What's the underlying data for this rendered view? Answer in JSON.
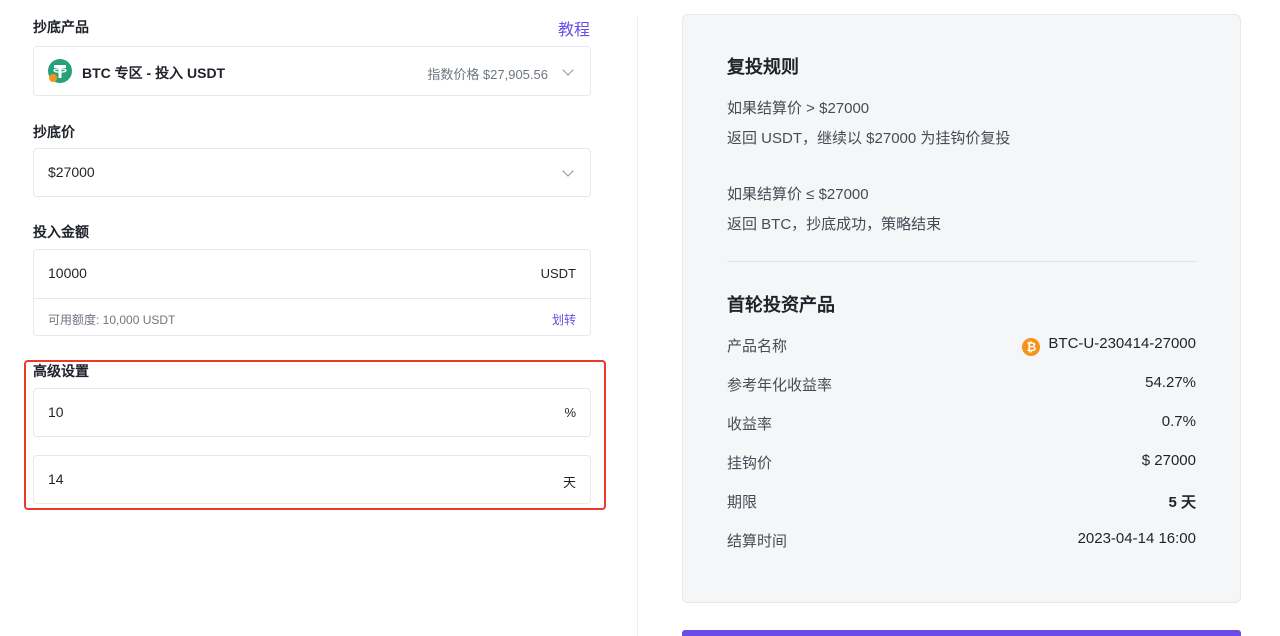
{
  "left": {
    "product": {
      "label": "抄底产品",
      "tutorial": "教程",
      "name": "BTC 专区 - 投入 USDT",
      "index_price": "指数价格 $27,905.56"
    },
    "price": {
      "label": "抄底价",
      "value": "$27000"
    },
    "amount": {
      "label": "投入金额",
      "value": "10000",
      "unit": "USDT",
      "available": "可用额度: 10,000 USDT",
      "transfer": "划转"
    },
    "advanced": {
      "label": "高级设置",
      "field1": {
        "value": "10",
        "unit": "%"
      },
      "field2": {
        "value": "14",
        "unit": "天"
      }
    }
  },
  "right": {
    "rules": {
      "title": "复投规则",
      "line1": "如果结算价 > $27000",
      "line2": "返回 USDT，继续以 $27000 为挂钩价复投",
      "line3": "如果结算价 ≤ $27000",
      "line4": "返回 BTC，抄底成功，策略结束"
    },
    "first_round": {
      "title": "首轮投资产品",
      "rows": [
        {
          "label": "产品名称",
          "value": "BTC-U-230414-27000"
        },
        {
          "label": "参考年化收益率",
          "value": "54.27%"
        },
        {
          "label": "收益率",
          "value": "0.7%"
        },
        {
          "label": "挂钩价",
          "value": "$ 27000"
        },
        {
          "label": "期限",
          "value": "5 天"
        },
        {
          "label": "结算时间",
          "value": "2023-04-14 16:00"
        }
      ]
    }
  },
  "colors": {
    "accent": "#6b4ce6",
    "highlight": "#ea3a2c",
    "tether": "#26a17b",
    "bitcoin": "#f7931a"
  }
}
